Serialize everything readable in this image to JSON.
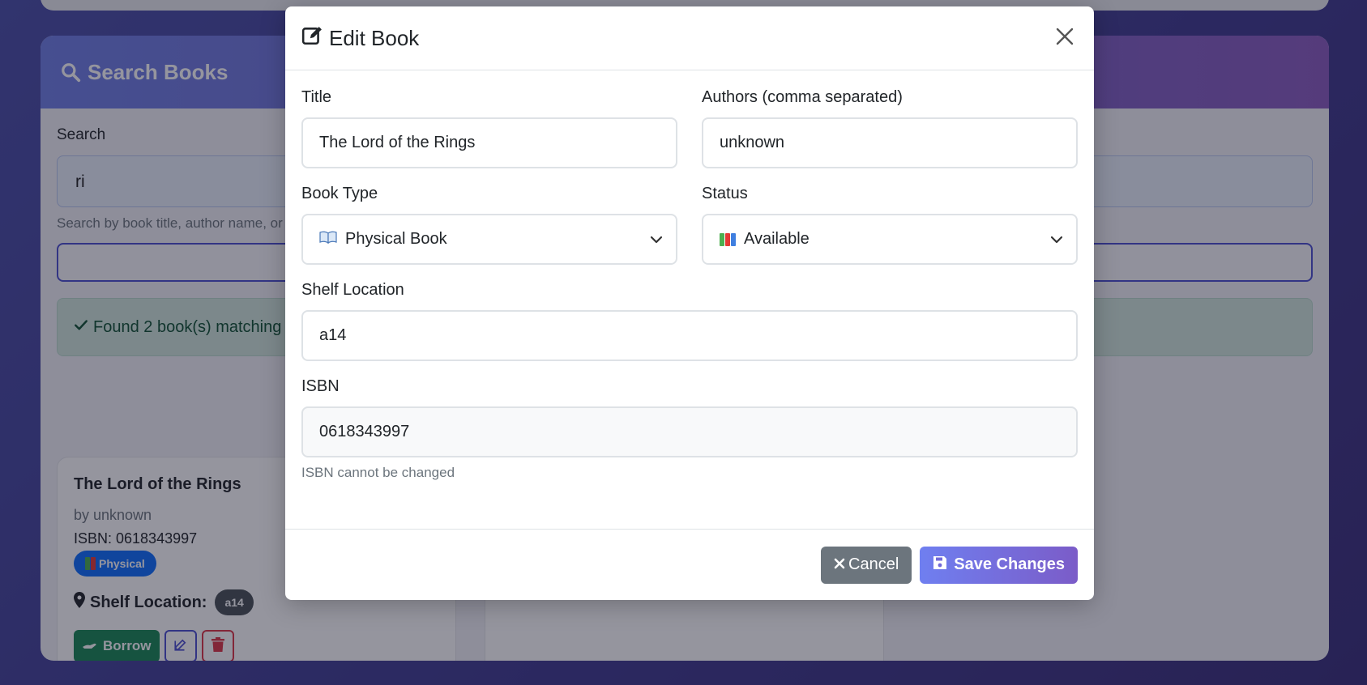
{
  "background": {
    "search_card": {
      "title": "Search Books",
      "search_label": "Search",
      "search_value": "ri",
      "search_helper": "Search by book title, author name, or",
      "alert_text": "Found 2 book(s) matching"
    },
    "book_cards": [
      {
        "title": "The Lord of the Rings",
        "author": "by unknown",
        "isbn": "ISBN: 0618343997",
        "type_badge": "Physical",
        "shelf_label": "Shelf Location:",
        "shelf_value": "a14",
        "borrow_label": "Borrow"
      }
    ]
  },
  "modal": {
    "title": "Edit Book",
    "fields": {
      "title": {
        "label": "Title",
        "value": "The Lord of the Rings"
      },
      "authors": {
        "label": "Authors (comma separated)",
        "value": "unknown"
      },
      "book_type": {
        "label": "Book Type",
        "value": "Physical Book",
        "icon": "open-book-icon"
      },
      "status": {
        "label": "Status",
        "value": "Available",
        "icon": "books-icon"
      },
      "shelf_location": {
        "label": "Shelf Location",
        "value": "a14"
      },
      "isbn": {
        "label": "ISBN",
        "value": "0618343997",
        "hint": "ISBN cannot be changed"
      }
    },
    "footer": {
      "cancel_label": "Cancel",
      "save_label": "Save Changes"
    }
  },
  "colors": {
    "accent_gradient_start": "#6f7ff0",
    "accent_gradient_end": "#7b5cc8",
    "success": "#198754",
    "danger": "#dc3545",
    "secondary": "#6c757d",
    "primary": "#0d6efd"
  }
}
